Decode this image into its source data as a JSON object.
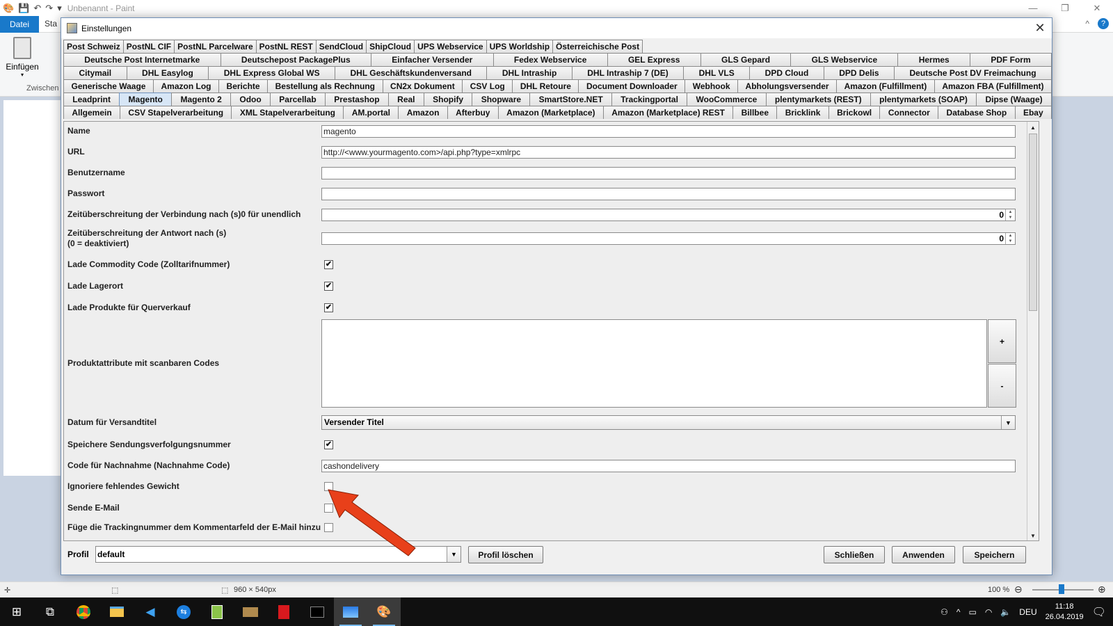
{
  "paint": {
    "title": "Unbenannt - Paint",
    "tab_datei": "Datei",
    "tab_start": "Sta",
    "clipboard_label": "Einfügen",
    "clipboard_group": "Zwischen",
    "status_size": "960 × 540px",
    "zoom": "100 %"
  },
  "dialog": {
    "title": "Einstellungen",
    "tab_rows": [
      [
        "Post Schweiz",
        "PostNL CIF",
        "PostNL Parcelware",
        "PostNL REST",
        "SendCloud",
        "ShipCloud",
        "UPS Webservice",
        "UPS Worldship",
        "Österreichische Post"
      ],
      [
        "Deutsche Post Internetmarke",
        "Deutschepost PackagePlus",
        "Einfacher Versender",
        "Fedex Webservice",
        "GEL Express",
        "GLS Gepard",
        "GLS Webservice",
        "Hermes",
        "PDF Form"
      ],
      [
        "Citymail",
        "DHL Easylog",
        "DHL Express Global WS",
        "DHL Geschäftskundenversand",
        "DHL Intraship",
        "DHL Intraship 7 (DE)",
        "DHL VLS",
        "DPD Cloud",
        "DPD Delis",
        "Deutsche Post DV Freimachung"
      ],
      [
        "Generische Waage",
        "Amazon Log",
        "Berichte",
        "Bestellung als Rechnung",
        "CN2x Dokument",
        "CSV Log",
        "DHL Retoure",
        "Document Downloader",
        "Webhook",
        "Abholungsversender",
        "Amazon (Fulfillment)",
        "Amazon FBA (Fulfillment)"
      ],
      [
        "Leadprint",
        "Magento",
        "Magento 2",
        "Odoo",
        "Parcellab",
        "Prestashop",
        "Real",
        "Shopify",
        "Shopware",
        "SmartStore.NET",
        "Trackingportal",
        "WooCommerce",
        "plentymarkets (REST)",
        "plentymarkets (SOAP)",
        "Dipse (Waage)"
      ],
      [
        "Allgemein",
        "CSV Stapelverarbeitung",
        "XML Stapelverarbeitung",
        "AM.portal",
        "Amazon",
        "Afterbuy",
        "Amazon (Marketplace)",
        "Amazon (Marketplace) REST",
        "Billbee",
        "Bricklink",
        "Brickowl",
        "Connector",
        "Database Shop",
        "Ebay"
      ]
    ],
    "selected_tab": "Magento",
    "form": {
      "name_label": "Name",
      "name_value": "magento",
      "url_label": "URL",
      "url_value": "http://<www.yourmagento.com>/api.php?type=xmlrpc",
      "user_label": "Benutzername",
      "user_value": "",
      "pass_label": "Passwort",
      "pass_value": "",
      "timeout_conn_label": "Zeitüberschreitung der Verbindung nach (s)0 für unendlich",
      "timeout_conn_value": "0",
      "timeout_resp_label1": "Zeitüberschreitung der Antwort nach (s)",
      "timeout_resp_label2": "(0 = deaktiviert)",
      "timeout_resp_value": "0",
      "commodity_label": "Lade Commodity Code (Zolltarifnummer)",
      "lagerort_label": "Lade Lagerort",
      "querverkauf_label": "Lade Produkte für Querverkauf",
      "attr_label": "Produktattribute mit scanbaren Codes",
      "plus": "+",
      "minus": "-",
      "datum_label": "Datum für Versandtitel",
      "datum_value": "Versender Titel",
      "tracking_label": "Speichere Sendungsverfolgungsnummer",
      "nachnahme_label": "Code für Nachnahme (Nachnahme Code)",
      "nachnahme_value": "cashondelivery",
      "gewicht_label": "Ignoriere fehlendes Gewicht",
      "email_label": "Sende E-Mail",
      "kommentar_label": "Füge die Trackingnummer dem Kommentarfeld der E-Mail hinzu",
      "check": "✔"
    },
    "profile_label": "Profil",
    "profile_value": "default",
    "btn_delete": "Profil löschen",
    "btn_close": "Schließen",
    "btn_apply": "Anwenden",
    "btn_save": "Speichern"
  },
  "taskbar": {
    "time": "11:18",
    "date": "26.04.2019",
    "lang": "DEU"
  },
  "colors": {
    "arrow": "#e8401a",
    "accent": "#1979ca"
  }
}
